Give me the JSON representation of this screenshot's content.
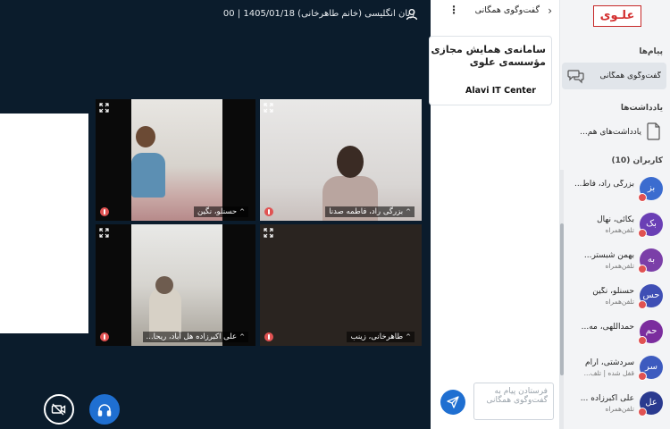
{
  "meeting": {
    "title": "زبان انگلیسی (خانم طاهرخانی) 1405/01/18 | 00"
  },
  "video_tiles": [
    {
      "name": "حسنلو، نگین"
    },
    {
      "name": "بزرگی راد، فاطمه صدنا"
    },
    {
      "name": "علی اکبرزاده هل آباد، ریحا..."
    },
    {
      "name": "طاهرخانی، زینب"
    }
  ],
  "chat": {
    "title": "گفت‌وگوی همگانی",
    "welcome_title": "سامانه‌ی همایش مجازی\nمؤسسه‌ی علوی",
    "welcome_sub": "Alavi IT Center",
    "input_placeholder": "فرستادن پیام به گفت‌وگوی همگانی"
  },
  "sidebar": {
    "logo_text": "علـوی",
    "messages_label": "پیام‌ها",
    "public_chat_label": "گفت‌وگوی همگانی",
    "notes_label": "یادداشت‌ها",
    "shared_notes_label": "یادداشت‌های هم...",
    "users_label": "کاربران (10)",
    "users": [
      {
        "initials": "بز",
        "name": "بزرگی راد، فاط...",
        "status": "",
        "color": "#3b6ccf"
      },
      {
        "initials": "بک",
        "name": "بکائی، نهال",
        "status": "تلفن‌همراه",
        "color": "#6a3fb5"
      },
      {
        "initials": "به",
        "name": "بهمن شبستر...",
        "status": "تلفن‌همراه",
        "color": "#7b3fa8"
      },
      {
        "initials": "حس",
        "name": "حسنلو، نگین",
        "status": "تلفن‌همراه",
        "color": "#3f4fb5"
      },
      {
        "initials": "حم",
        "name": "حمداللهی، مه...",
        "status": "",
        "color": "#7b2d9e"
      },
      {
        "initials": "سر",
        "name": "سردشتی، آرام",
        "status": "قفل شده | تلف...",
        "color": "#3d5bbf"
      },
      {
        "initials": "عل",
        "name": "علی اکبرزاده ...",
        "status": "تلفن‌همراه",
        "color": "#2a3a8f"
      }
    ]
  },
  "colors": {
    "main_bg": "#0b1c2c",
    "accent_blue": "#1f6fd1",
    "mic_off_red": "#e05252",
    "logo_red": "#d32f2f"
  }
}
